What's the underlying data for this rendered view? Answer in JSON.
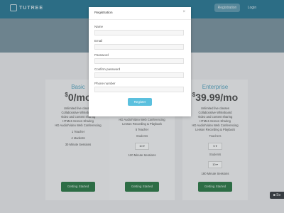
{
  "header": {
    "brand": "TUTREE",
    "register_label": "Registration",
    "login_label": "Login"
  },
  "plans": [
    {
      "name": "Basic",
      "currency": "$",
      "price": "0/mo",
      "features": [
        "Unlimited live classes",
        "Collaborative Whiteboard",
        "Video and content sharing",
        "HTML5 Screen Sharing",
        "HD Audio/Video Web Conferencing"
      ],
      "teachers": "1 Teacher",
      "students": "4 students",
      "minutes": "30 Minute Sessions",
      "cta": "Getting Started"
    },
    {
      "name": "",
      "features": [
        "HD Audio/Video Web Conferencing",
        "Lesson Recording & Playback"
      ],
      "teachers": "5 Teacher",
      "students_label": "Students",
      "students_value": "10",
      "minutes": "120 Minute Sessions",
      "cta": "Getting Started"
    },
    {
      "name": "Enterprise",
      "currency": "$",
      "price": "39.99/mo",
      "features": [
        "Unlimited live classes",
        "Collaborative Whiteboard",
        "Video and content sharing",
        "HTML5 Screen Sharing",
        "HD Audio/Video Web Conferencing",
        "Lesson Recording & Playback"
      ],
      "teachers_label": "Teachers",
      "teachers_value": "5",
      "students_label": "Students",
      "students_value": "10",
      "minutes": "180 Minute Sessions",
      "cta": "Getting Started"
    }
  ],
  "chat": {
    "label": "■ So"
  },
  "modal": {
    "title": "Registration",
    "close": "×",
    "fields": [
      "Name",
      "Email",
      "Password",
      "Confirm password",
      "Phone number"
    ],
    "submit_label": "Register"
  },
  "icons": {
    "close": "close-icon",
    "chevron": "chevron-down-icon",
    "logo": "logo-icon"
  },
  "colors": {
    "header": "#2e7a97",
    "accent": "#5bc0de",
    "cta": "#2f7a49",
    "plan_name": "#5aa7c2"
  }
}
